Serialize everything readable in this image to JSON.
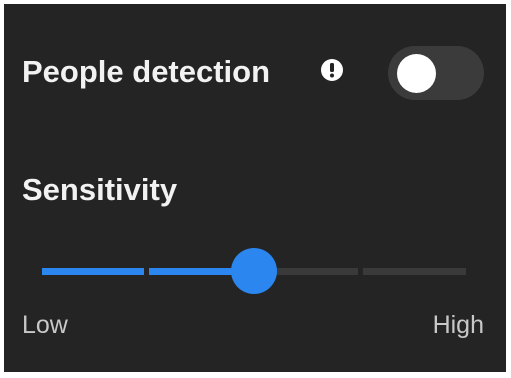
{
  "people_detection": {
    "label": "People detection",
    "info_icon": "exclamation-info-icon",
    "toggle_on": false
  },
  "sensitivity": {
    "label": "Sensitivity",
    "steps": 4,
    "value_fraction": 0.5,
    "min_label": "Low",
    "max_label": "High"
  },
  "colors": {
    "background": "#242424",
    "accent": "#2b86f0",
    "track_inactive": "#3a3a3a",
    "toggle_off": "#3b3b3b"
  }
}
